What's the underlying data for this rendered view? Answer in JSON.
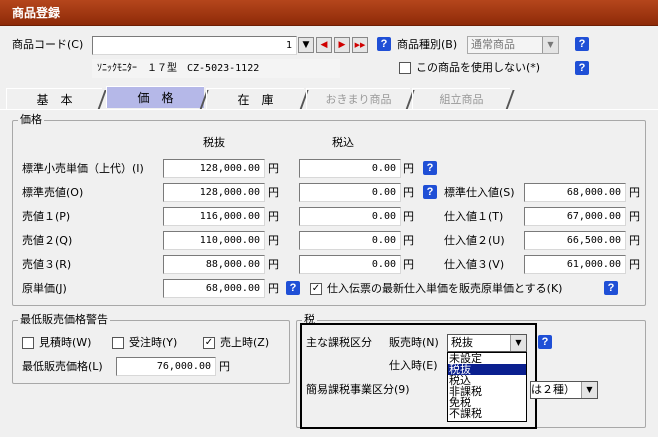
{
  "window": {
    "title": "商品登録"
  },
  "header": {
    "code_label": "商品コード(C)",
    "code_value": "1",
    "kind_label": "商品種別(B)",
    "kind_value": "通常商品",
    "product_name": "ｿﾆｯｸﾓﾆﾀｰ　１７型　CZ-5023-1122",
    "disable_label": "この商品を使用しない(*)",
    "nav": [
      "▼",
      "◀",
      "▶",
      "▶▶"
    ]
  },
  "tabs": [
    "基　本",
    "価　格",
    "在　庫",
    "おきまり商品",
    "組立商品"
  ],
  "price": {
    "group_label": "価格",
    "col_excl": "税抜",
    "col_incl": "税込",
    "yen": "円",
    "rows": [
      {
        "label": "標準小売単価（上代）(I)",
        "excl": "128,000.00",
        "incl": "0.00"
      },
      {
        "label": "標準売値(O)",
        "excl": "128,000.00",
        "incl": "0.00"
      },
      {
        "label": "売値１(P)",
        "excl": "116,000.00",
        "incl": "0.00"
      },
      {
        "label": "売値２(Q)",
        "excl": "110,000.00",
        "incl": "0.00"
      },
      {
        "label": "売値３(R)",
        "excl": "88,000.00",
        "incl": "0.00"
      }
    ],
    "purchase": [
      {
        "label": "標準仕入値(S)",
        "value": "68,000.00"
      },
      {
        "label": "仕入値１(T)",
        "value": "67,000.00"
      },
      {
        "label": "仕入値２(U)",
        "value": "66,500.00"
      },
      {
        "label": "仕入値３(V)",
        "value": "61,000.00"
      }
    ],
    "cost_label": "原単価(J)",
    "cost_value": "68,000.00",
    "cost_check_label": "仕入伝票の最新仕入単価を販売原単価とする(K)"
  },
  "min_price": {
    "group_label": "最低販売価格警告",
    "estimate": "見積時(W)",
    "order": "受注時(Y)",
    "sale": "売上時(Z)",
    "field_label": "最低販売価格(L)",
    "field_value": "76,000.00",
    "yen": "円"
  },
  "tax": {
    "group_label": "税",
    "main_label": "主な課税区分",
    "sale_label": "販売時(N)",
    "sale_value": "税抜",
    "purchase_label": "仕入時(E)",
    "simple_label": "簡易課税事業区分(9)",
    "simple_suffix": "は２種）",
    "options": [
      "未設定",
      "税抜",
      "税込",
      "非課税",
      "免税",
      "不課税"
    ]
  }
}
